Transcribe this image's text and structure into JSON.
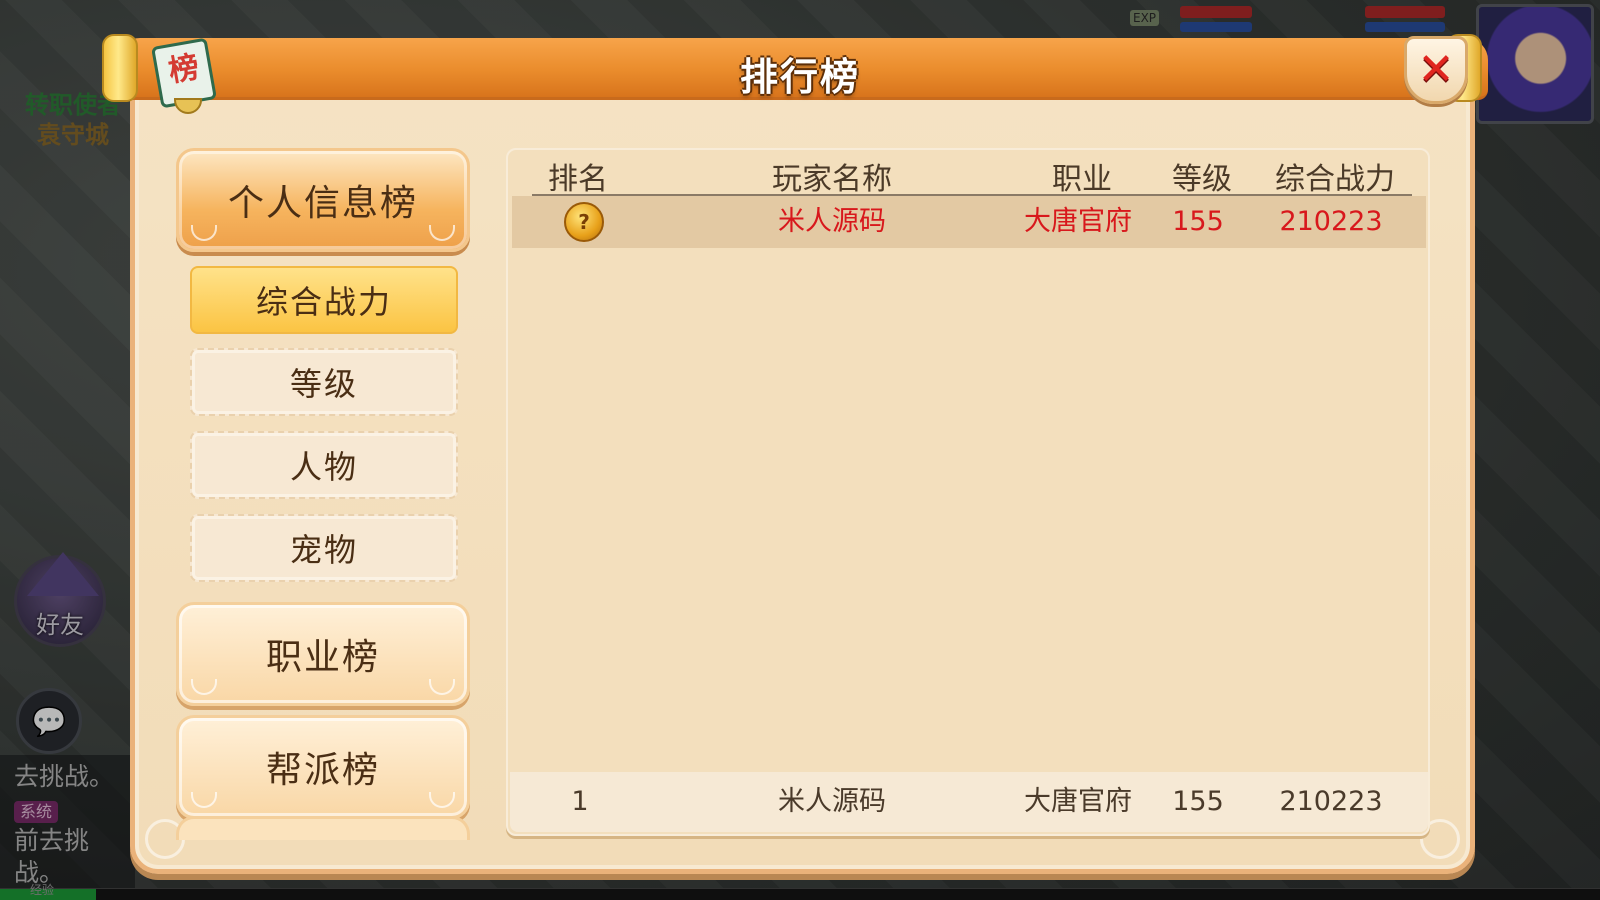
{
  "window": {
    "title": "排行榜",
    "badge_glyph": "榜"
  },
  "background": {
    "npc_name": "转职使者",
    "npc_city": "袁守城",
    "friend_label": "好友",
    "chat_lines": [
      "去挑战。",
      "前去挑战。"
    ],
    "chat_tag": "系统",
    "exp_label": "经验",
    "hud_exp": "EXP"
  },
  "menu": {
    "categories": [
      {
        "label": "个人信息榜",
        "active": true
      },
      {
        "label": "职业榜",
        "active": false
      },
      {
        "label": "帮派榜",
        "active": false
      }
    ],
    "subitems": [
      {
        "label": "综合战力",
        "active": true
      },
      {
        "label": "等级",
        "active": false
      },
      {
        "label": "人物",
        "active": false
      },
      {
        "label": "宠物",
        "active": false
      }
    ]
  },
  "table": {
    "columns": [
      "排名",
      "玩家名称",
      "职业",
      "等级",
      "综合战力"
    ],
    "rows": [
      {
        "rank_icon": "gold-medal-icon",
        "name": "米人源码",
        "class": "大唐官府",
        "level": "155",
        "power": "210223"
      }
    ],
    "my_rank": {
      "rank": "1",
      "name": "米人源码",
      "class": "大唐官府",
      "level": "155",
      "power": "210223"
    }
  },
  "colors": {
    "title_bar": "#ea8c2c",
    "highlight_text": "#d8181c",
    "active_sub": "#fbc443",
    "close_x": "#e0251f"
  }
}
